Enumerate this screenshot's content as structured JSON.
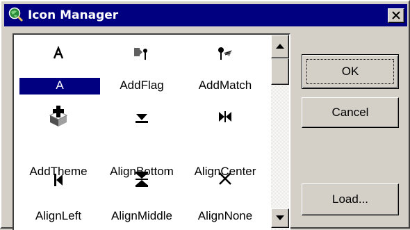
{
  "window": {
    "title": "Icon Manager",
    "title_icon": "globe-magnifier-icon",
    "close_icon": "close-icon",
    "titlebar_color": "#000080",
    "background_color": "#d4d0c8"
  },
  "icon_list": {
    "selection_color": "#000080",
    "items": [
      {
        "label": "A",
        "icon": "letter-a-icon",
        "selected": false
      },
      {
        "label": "AddFlag",
        "icon": "add-flag-icon",
        "selected": false
      },
      {
        "label": "AddMatch",
        "icon": "add-match-icon",
        "selected": false
      },
      {
        "label": "A",
        "icon": "",
        "selected": true
      },
      {
        "label": "",
        "icon": "add-theme-icon",
        "selected": false
      },
      {
        "label": "",
        "icon": "align-bottom-icon",
        "selected": false
      },
      {
        "label": "",
        "icon": "align-center-icon",
        "selected": false
      },
      {
        "label": "AddTheme",
        "icon": "align-left-icon",
        "selected": false
      },
      {
        "label": "AlignBottom",
        "icon": "align-middle-icon",
        "selected": false
      },
      {
        "label": "AlignCenter",
        "icon": "align-none-icon",
        "selected": false
      },
      {
        "label": "AlignLeft",
        "icon": "",
        "selected": false
      },
      {
        "label": "AlignMiddle",
        "icon": "",
        "selected": false
      },
      {
        "label": "AlignNone",
        "icon": "",
        "selected": false
      }
    ]
  },
  "scrollbar": {
    "up_icon": "scroll-up-arrow-icon",
    "down_icon": "scroll-down-arrow-icon"
  },
  "buttons": {
    "ok": "OK",
    "cancel": "Cancel",
    "load": "Load..."
  }
}
